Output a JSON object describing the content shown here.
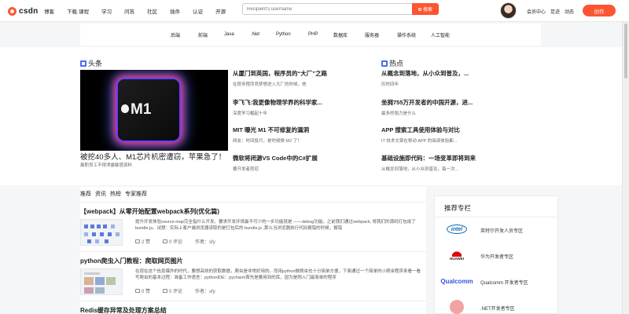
{
  "header": {
    "logo_text": "csdn",
    "nav": [
      "博客",
      "下载·课程",
      "学习",
      "问答",
      "社区",
      "插件",
      "认证",
      "开源"
    ],
    "search_placeholder": "Recipient's username",
    "search_button": "搜索",
    "right_links": [
      "会员中心",
      "足迹",
      "动态"
    ],
    "create_button": "创作"
  },
  "categories": [
    "后端",
    "前端",
    "Java",
    ".Net",
    "Python",
    "PHP",
    "数据库",
    "服务器",
    "操作系统",
    "人工智能"
  ],
  "headlines": {
    "title": "头条",
    "hero_image_text": "M1",
    "hero_caption": "被挖40多人、M1芯片机密遭窃，苹果急了！",
    "hero_sub": "离职员工不得泄露敏感资料",
    "articles": [
      {
        "title": "从厦门到英国，程序员的“大厂”之路",
        "desc": "在很多程序员梦想进入大厂的时候，他"
      },
      {
        "title": "李飞飞:我更像物理学界的科学家...",
        "desc": "深度学习崛起十年"
      },
      {
        "title": "MIT 曝光 M1 不可修复的漏洞",
        "desc": "网友：时间挺巧，是时候换 M2 了！"
      },
      {
        "title": "微软将闭源VS Code中的C#扩展",
        "desc": "要开发者怒怼"
      }
    ]
  },
  "hot": {
    "title": "热点",
    "articles": [
      {
        "title": "从概念到落地，从小众到普及，...",
        "desc": "历时四年"
      },
      {
        "title": "坐拥755万开发者的中国开源，进...",
        "desc": "最多的阻力是什么"
      },
      {
        "title": "APP 搜索工具使用体验与对比",
        "desc": "IT 技术文章在移动 APP 的阅读体验都..."
      },
      {
        "title": "基础设施即代码：一场变革即将到来",
        "desc": "从概念到落地，从小众到普及，每一次..."
      }
    ]
  },
  "feed": {
    "tabs": [
      "推荐",
      "资讯",
      "热榜",
      "专家推荐"
    ],
    "items": [
      {
        "title": "【webpack】从零开始配置webpack系列(优化篇)",
        "desc": "提升开发体验source-map完全指什么开发。要求开发环境最不可少的一步功能就是 ——debug功能。之前我们通过webpack, 将我们的源码打包成了 bundle.js。试想：实际上客户端浏览器读取的是打包后的 bundle.js ,那么当浏览器执行代码报错的时候，报错",
        "likes": "2 赞",
        "comments": "0 评论",
        "author": "作者：sfy"
      },
      {
        "title": "python爬虫入门教程：爬取网页图片",
        "desc": "在现在这个信息爆炸的时代，要想高效的获取数据，爬虫是非常好用的。而用python做爬虫也十分简单方便，下面通过一个简单的小爬虫程序来看一看写爬虫的基本过程：准备工作语言：pythonIDE：pycharm首先是要用到的库，因为是刚入门最简单的程序",
        "likes": "0 赞",
        "comments": "0 评论",
        "author": "作者：sfy"
      },
      {
        "title": "Redis缓存异常及处理方案总结",
        "desc": "",
        "likes": "",
        "comments": "",
        "author": ""
      }
    ]
  },
  "recommend": {
    "title": "推荐专栏",
    "items": [
      {
        "logo": "intel",
        "name": "英特尔开发人员专区"
      },
      {
        "logo": "HUAWEI",
        "name": "华为开发者专区"
      },
      {
        "logo": "Qualcomm",
        "name": "Qualcomm 开发者专区"
      },
      {
        "logo": "",
        "name": ".NET开发者专区"
      }
    ]
  }
}
